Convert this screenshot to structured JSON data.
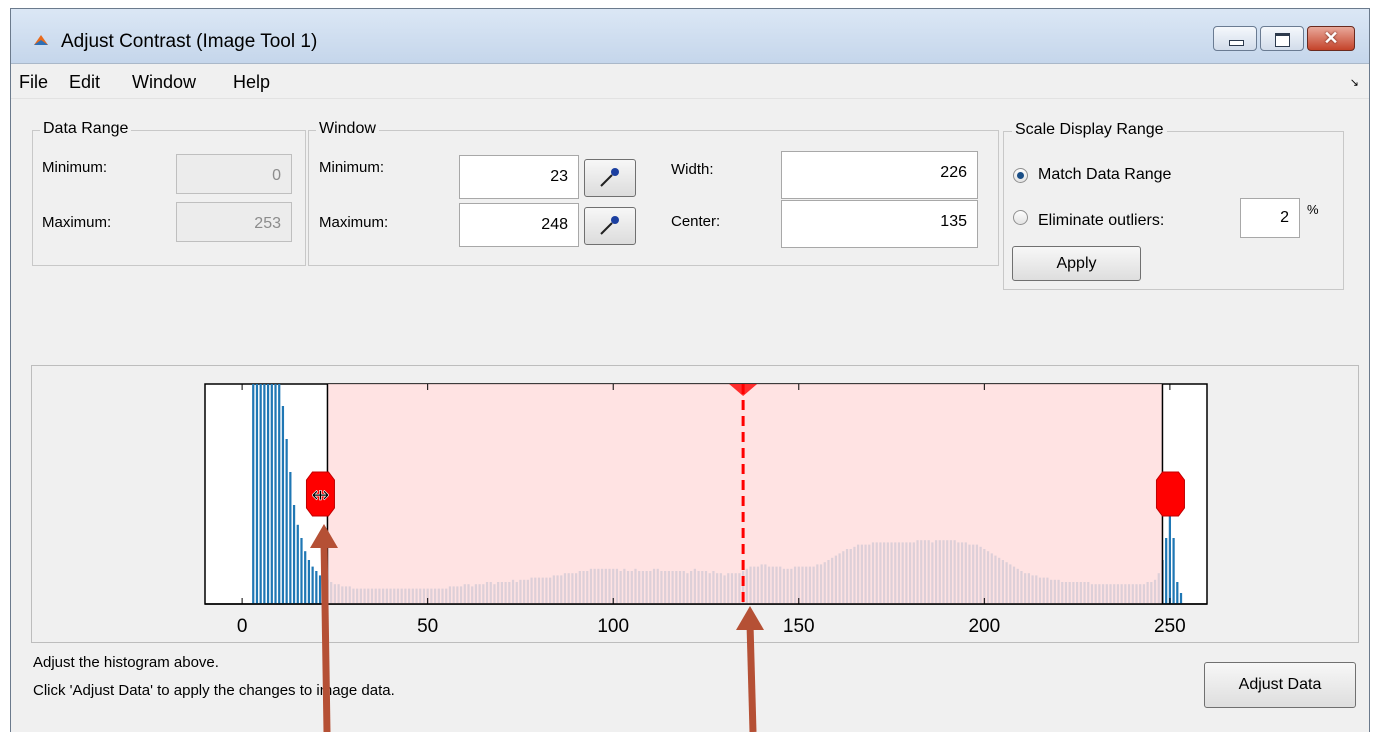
{
  "window": {
    "title": "Adjust Contrast (Image Tool 1)",
    "close_glyph": "✕"
  },
  "menu": [
    "File",
    "Edit",
    "Window",
    "Help"
  ],
  "menu_dock_glyph": "↘",
  "data_range": {
    "title": "Data Range",
    "min_label": "Minimum:",
    "min_value": "0",
    "max_label": "Maximum:",
    "max_value": "253"
  },
  "window_group": {
    "title": "Window",
    "min_label": "Minimum:",
    "min_value": "23",
    "max_label": "Maximum:",
    "max_value": "248",
    "width_label": "Width:",
    "width_value": "226",
    "center_label": "Center:",
    "center_value": "135"
  },
  "scale_display": {
    "title": "Scale Display Range",
    "match_label": "Match Data Range",
    "match_selected": true,
    "eliminate_label": "Eliminate outliers:",
    "outlier_value": "2",
    "percent": "%",
    "apply_label": "Apply"
  },
  "chart_data": {
    "type": "bar",
    "xlim": [
      -10,
      260
    ],
    "xticks": [
      0,
      50,
      100,
      150,
      200,
      250
    ],
    "tick_labels": [
      "0",
      "50",
      "100",
      "150",
      "200",
      "250"
    ],
    "window_min": 23,
    "window_max": 248,
    "window_center": 135,
    "bar_color": "#1f77b4",
    "window_fill_color": "#ffdede",
    "handle_color": "#ff0000",
    "bins": [
      0,
      1,
      2,
      3,
      4,
      5,
      6,
      7,
      8,
      9,
      10,
      11,
      12,
      13,
      14,
      15,
      16,
      17,
      18,
      19,
      20,
      21,
      22,
      23,
      24,
      25,
      26,
      27,
      28,
      29,
      30,
      31,
      32,
      33,
      34,
      35,
      36,
      37,
      38,
      39,
      40,
      41,
      42,
      43,
      44,
      45,
      46,
      47,
      48,
      49,
      50,
      51,
      52,
      53,
      54,
      55,
      56,
      57,
      58,
      59,
      60,
      61,
      62,
      63,
      64,
      65,
      66,
      67,
      68,
      69,
      70,
      71,
      72,
      73,
      74,
      75,
      76,
      77,
      78,
      79,
      80,
      81,
      82,
      83,
      84,
      85,
      86,
      87,
      88,
      89,
      90,
      91,
      92,
      93,
      94,
      95,
      96,
      97,
      98,
      99,
      100,
      101,
      102,
      103,
      104,
      105,
      106,
      107,
      108,
      109,
      110,
      111,
      112,
      113,
      114,
      115,
      116,
      117,
      118,
      119,
      120,
      121,
      122,
      123,
      124,
      125,
      126,
      127,
      128,
      129,
      130,
      131,
      132,
      133,
      134,
      135,
      136,
      137,
      138,
      139,
      140,
      141,
      142,
      143,
      144,
      145,
      146,
      147,
      148,
      149,
      150,
      151,
      152,
      153,
      154,
      155,
      156,
      157,
      158,
      159,
      160,
      161,
      162,
      163,
      164,
      165,
      166,
      167,
      168,
      169,
      170,
      171,
      172,
      173,
      174,
      175,
      176,
      177,
      178,
      179,
      180,
      181,
      182,
      183,
      184,
      185,
      186,
      187,
      188,
      189,
      190,
      191,
      192,
      193,
      194,
      195,
      196,
      197,
      198,
      199,
      200,
      201,
      202,
      203,
      204,
      205,
      206,
      207,
      208,
      209,
      210,
      211,
      212,
      213,
      214,
      215,
      216,
      217,
      218,
      219,
      220,
      221,
      222,
      223,
      224,
      225,
      226,
      227,
      228,
      229,
      230,
      231,
      232,
      233,
      234,
      235,
      236,
      237,
      238,
      239,
      240,
      241,
      242,
      243,
      244,
      245,
      246,
      247,
      248,
      249,
      250,
      251,
      252,
      253
    ],
    "counts": [
      0,
      0,
      0,
      1.0,
      1.0,
      1.0,
      1.0,
      1.0,
      1.0,
      1.0,
      1.0,
      0.9,
      0.75,
      0.6,
      0.45,
      0.36,
      0.3,
      0.24,
      0.2,
      0.17,
      0.15,
      0.13,
      0.12,
      0.11,
      0.1,
      0.09,
      0.09,
      0.08,
      0.08,
      0.08,
      0.07,
      0.07,
      0.07,
      0.07,
      0.07,
      0.07,
      0.07,
      0.07,
      0.07,
      0.07,
      0.07,
      0.07,
      0.07,
      0.07,
      0.07,
      0.07,
      0.07,
      0.07,
      0.07,
      0.07,
      0.07,
      0.07,
      0.07,
      0.07,
      0.07,
      0.07,
      0.08,
      0.08,
      0.08,
      0.08,
      0.09,
      0.09,
      0.08,
      0.09,
      0.09,
      0.09,
      0.1,
      0.1,
      0.09,
      0.1,
      0.1,
      0.1,
      0.1,
      0.11,
      0.1,
      0.11,
      0.11,
      0.11,
      0.12,
      0.12,
      0.12,
      0.12,
      0.12,
      0.12,
      0.13,
      0.13,
      0.13,
      0.14,
      0.14,
      0.14,
      0.14,
      0.15,
      0.15,
      0.15,
      0.16,
      0.16,
      0.16,
      0.16,
      0.16,
      0.16,
      0.16,
      0.16,
      0.15,
      0.16,
      0.15,
      0.15,
      0.16,
      0.15,
      0.15,
      0.15,
      0.15,
      0.16,
      0.16,
      0.15,
      0.15,
      0.15,
      0.15,
      0.15,
      0.15,
      0.15,
      0.14,
      0.15,
      0.16,
      0.15,
      0.15,
      0.15,
      0.14,
      0.15,
      0.14,
      0.14,
      0.13,
      0.14,
      0.14,
      0.14,
      0.14,
      0.15,
      0.16,
      0.17,
      0.17,
      0.17,
      0.18,
      0.18,
      0.17,
      0.17,
      0.17,
      0.17,
      0.16,
      0.16,
      0.16,
      0.17,
      0.17,
      0.17,
      0.17,
      0.17,
      0.17,
      0.18,
      0.18,
      0.19,
      0.2,
      0.21,
      0.22,
      0.23,
      0.24,
      0.25,
      0.25,
      0.26,
      0.27,
      0.27,
      0.27,
      0.27,
      0.28,
      0.28,
      0.28,
      0.28,
      0.28,
      0.28,
      0.28,
      0.28,
      0.28,
      0.28,
      0.28,
      0.28,
      0.29,
      0.29,
      0.29,
      0.29,
      0.28,
      0.29,
      0.29,
      0.29,
      0.29,
      0.29,
      0.29,
      0.28,
      0.28,
      0.28,
      0.27,
      0.27,
      0.27,
      0.26,
      0.25,
      0.24,
      0.23,
      0.22,
      0.21,
      0.2,
      0.19,
      0.18,
      0.17,
      0.16,
      0.15,
      0.14,
      0.14,
      0.13,
      0.13,
      0.12,
      0.12,
      0.12,
      0.11,
      0.11,
      0.11,
      0.1,
      0.1,
      0.1,
      0.1,
      0.1,
      0.1,
      0.1,
      0.1,
      0.09,
      0.09,
      0.09,
      0.09,
      0.09,
      0.09,
      0.09,
      0.09,
      0.09,
      0.09,
      0.09,
      0.09,
      0.09,
      0.09,
      0.09,
      0.1,
      0.1,
      0.11,
      0.14,
      0.2,
      0.3,
      0.6,
      0.3,
      0.1,
      0.05,
      0.02
    ]
  },
  "status": {
    "line1": "Adjust the histogram above.",
    "line2": "Click 'Adjust Data' to apply the changes to image data."
  },
  "adjust_data_label": "Adjust Data",
  "annotation_color": "#b55035"
}
